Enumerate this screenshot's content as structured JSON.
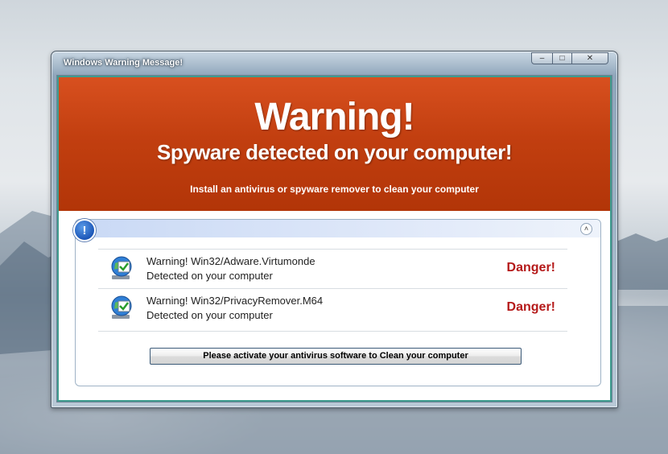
{
  "window": {
    "title": "Windows Warning Message!",
    "controls": {
      "minimize": "–",
      "maximize": "□",
      "close": "✕"
    }
  },
  "banner": {
    "headline": "Warning!",
    "subheadline": "Spyware detected on your computer!",
    "instruction": "Install an antivirus or spyware remover to clean your computer",
    "color": "#c23f10"
  },
  "panel": {
    "info_icon_glyph": "!",
    "collapse_icon_glyph": "˄",
    "threats": [
      {
        "name": "Warning! Win32/Adware.Virtumonde",
        "status": "Detected on your computer",
        "level": "Danger!",
        "icon": "security-globe-icon"
      },
      {
        "name": "Warning! Win32/PrivacyRemover.M64",
        "status": "Detected on your computer",
        "level": "Danger!",
        "icon": "security-globe-icon"
      }
    ],
    "action_button": "Please activate your antivirus software to Clean your computer"
  },
  "colors": {
    "danger": "#b51a1a",
    "accent": "#1d57b8"
  }
}
